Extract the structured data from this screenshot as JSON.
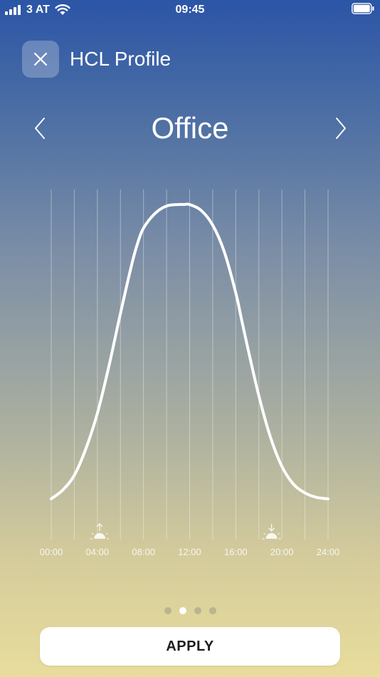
{
  "status_bar": {
    "carrier": "3 AT",
    "time": "09:45",
    "icons": [
      "signal-icon",
      "wifi-icon",
      "battery-icon"
    ]
  },
  "header": {
    "title": "HCL Profile",
    "close_icon": "close-icon"
  },
  "profile_selector": {
    "name": "Office",
    "prev_icon": "chevron-left-icon",
    "next_icon": "chevron-right-icon"
  },
  "chart_data": {
    "type": "line",
    "title": "",
    "xlabel": "",
    "ylabel": "",
    "grid": true,
    "x_ticks": [
      "00:00",
      "04:00",
      "08:00",
      "12:00",
      "16:00",
      "20:00",
      "24:00"
    ],
    "xlim": [
      0,
      24
    ],
    "ylim": [
      0,
      1
    ],
    "series": [
      {
        "x": [
          0,
          1,
          2,
          3,
          4,
          5,
          6,
          7,
          7.5,
          8,
          9,
          10,
          11,
          11.5,
          12,
          13,
          14,
          15,
          16,
          16.5,
          17,
          18,
          19,
          20,
          21,
          22,
          23,
          24
        ],
        "y": [
          0.0,
          0.03,
          0.08,
          0.17,
          0.29,
          0.45,
          0.63,
          0.8,
          0.87,
          0.92,
          0.97,
          0.995,
          1.0,
          1.0,
          1.0,
          0.98,
          0.93,
          0.84,
          0.7,
          0.61,
          0.52,
          0.35,
          0.21,
          0.11,
          0.05,
          0.02,
          0.005,
          0.0
        ]
      }
    ],
    "markers": [
      {
        "icon": "sunrise-icon",
        "x": 4.2
      },
      {
        "icon": "sunset-icon",
        "x": 19.1
      }
    ]
  },
  "pagination": {
    "count": 4,
    "active_index": 1
  },
  "apply_button": {
    "label": "APPLY"
  },
  "colors": {
    "gradient_top": "#2b55a6",
    "gradient_bottom": "#e8dd9c",
    "curve": "#ffffff",
    "apply_text": "#1d1d1d"
  }
}
